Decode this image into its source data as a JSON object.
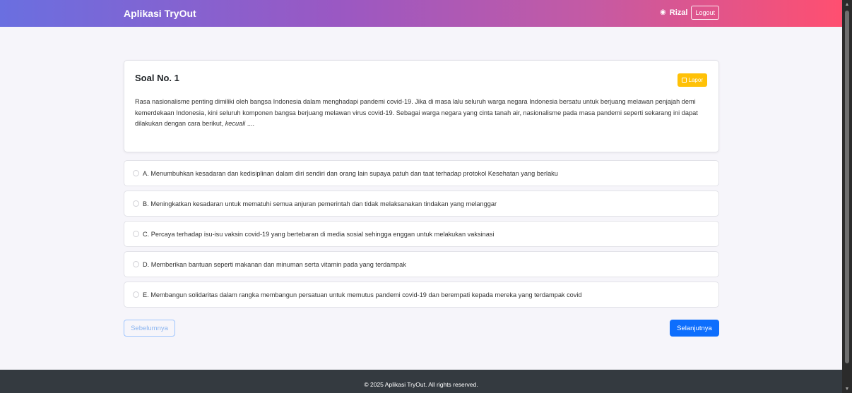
{
  "navbar": {
    "brand": "Aplikasi TryOut",
    "user_icon": "user-circle-icon",
    "user_name": "Rizal",
    "logout_label": "Logout"
  },
  "question": {
    "title": "Soal No. 1",
    "report_label": "Lapor",
    "report_icon": "flag-icon",
    "text_main": "Rasa nasionalisme penting dimiliki oleh bangsa Indonesia dalam menghadapi pandemi covid-19. Jika di masa lalu seluruh warga negara Indonesia bersatu untuk berjuang melawan penjajah demi kemerdekaan Indonesia, kini seluruh komponen bangsa berjuang melawan virus covid-19. Sebagai warga negara yang cinta tanah air, nasionalisme pada masa pandemi seperti sekarang ini dapat dilakukan dengan cara berikut,",
    "text_emphasis": "kecuali",
    "text_tail": " ...."
  },
  "options": [
    {
      "label": "A. Menumbuhkan kesadaran dan kedisiplinan dalam diri sendiri dan orang lain supaya patuh dan taat terhadap protokol Kesehatan yang berlaku",
      "selected": false
    },
    {
      "label": "B. Meningkatkan kesadaran untuk mematuhi semua anjuran pemerintah dan tidak melaksanakan tindakan yang melanggar",
      "selected": false
    },
    {
      "label": "C. Percaya terhadap isu-isu vaksin covid-19 yang bertebaran di media sosial sehingga enggan untuk melakukan vaksinasi",
      "selected": false
    },
    {
      "label": "D. Memberikan bantuan seperti makanan dan minuman serta vitamin pada yang terdampak",
      "selected": false
    },
    {
      "label": "E. Membangun solidaritas dalam rangka membangun persatuan untuk memutus pandemi covid-19 dan berempati kepada mereka yang terdampak covid",
      "selected": false
    }
  ],
  "navigation": {
    "prev_label": "Sebelumnya",
    "next_label": "Selanjutnya"
  },
  "footer": {
    "text": "© 2025 Aplikasi TryOut. All rights reserved."
  },
  "colors": {
    "navbar_gradient_start": "#6a6fe0",
    "navbar_gradient_end": "#ff4f70",
    "report_button": "#ffc107",
    "next_button": "#0d6efd",
    "footer_bg": "#343a40"
  }
}
